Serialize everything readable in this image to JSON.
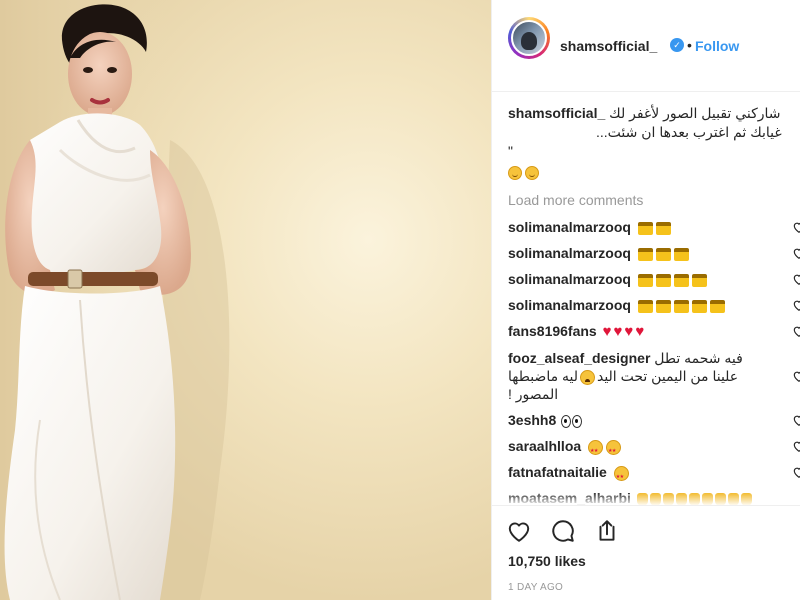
{
  "post": {
    "username": "shamsofficial_",
    "verified": true,
    "separator": "•",
    "follow_label": "Follow",
    "caption": {
      "username": "shamsofficial_",
      "line1": "شاركني تقبيل الصور لأغفر لك",
      "line2": "غيابك ثم اغترب بعدها ان شئت...",
      "line3": "\"",
      "emojis": [
        "smiling-face-icon",
        "smiling-face-icon"
      ]
    },
    "load_more_label": "Load more comments",
    "comments": [
      {
        "user": "solimanalmarzooq",
        "text": "",
        "emojis": [
          "banknote-emoji",
          "banknote-emoji"
        ]
      },
      {
        "user": "solimanalmarzooq",
        "text": "",
        "emojis": [
          "banknote-emoji",
          "banknote-emoji",
          "banknote-emoji"
        ]
      },
      {
        "user": "solimanalmarzooq",
        "text": "",
        "emojis": [
          "banknote-emoji",
          "banknote-emoji",
          "banknote-emoji",
          "banknote-emoji"
        ]
      },
      {
        "user": "solimanalmarzooq",
        "text": "",
        "emojis": [
          "banknote-emoji",
          "banknote-emoji",
          "banknote-emoji",
          "banknote-emoji",
          "banknote-emoji"
        ]
      },
      {
        "user": "fans8196fans",
        "text": "",
        "emojis": [
          "red-heart-emoji",
          "red-heart-emoji",
          "red-heart-emoji",
          "red-heart-emoji"
        ]
      },
      {
        "user": "fooz_alseaf_designer",
        "text_line1": "فيه شحمه تطل",
        "text_line2a": "علينا من اليمين تحت اليد",
        "text_line2b": "ليه ماضبطها",
        "text_line3": "! المصور"
      },
      {
        "user": "3eshh8",
        "text": "",
        "emojis": [
          "eyes-emoji"
        ]
      },
      {
        "user": "saraalhlloa",
        "text": "",
        "emojis": [
          "star-struck-emoji",
          "star-struck-emoji"
        ]
      },
      {
        "user": "fatnafatnaitalie",
        "text": "",
        "emojis": [
          "star-struck-emoji"
        ]
      },
      {
        "user": "moatasem_alharbi",
        "text": "",
        "emojis": [
          "clapping-hands-emoji",
          "clapping-hands-emoji",
          "clapping-hands-emoji",
          "clapping-hands-emoji",
          "clapping-hands-emoji",
          "clapping-hands-emoji",
          "clapping-hands-emoji",
          "clapping-hands-emoji",
          "clapping-hands-emoji"
        ]
      }
    ],
    "actions": {
      "like_icon": "heart-icon",
      "comment_icon": "comment-icon",
      "share_icon": "share-icon"
    },
    "likes": "10,750 likes",
    "timestamp": "1 DAY AGO"
  },
  "colors": {
    "link_blue": "#3897f0",
    "text": "#262626",
    "muted": "#999999",
    "border": "#efefef",
    "heart_red": "#e0163a"
  }
}
